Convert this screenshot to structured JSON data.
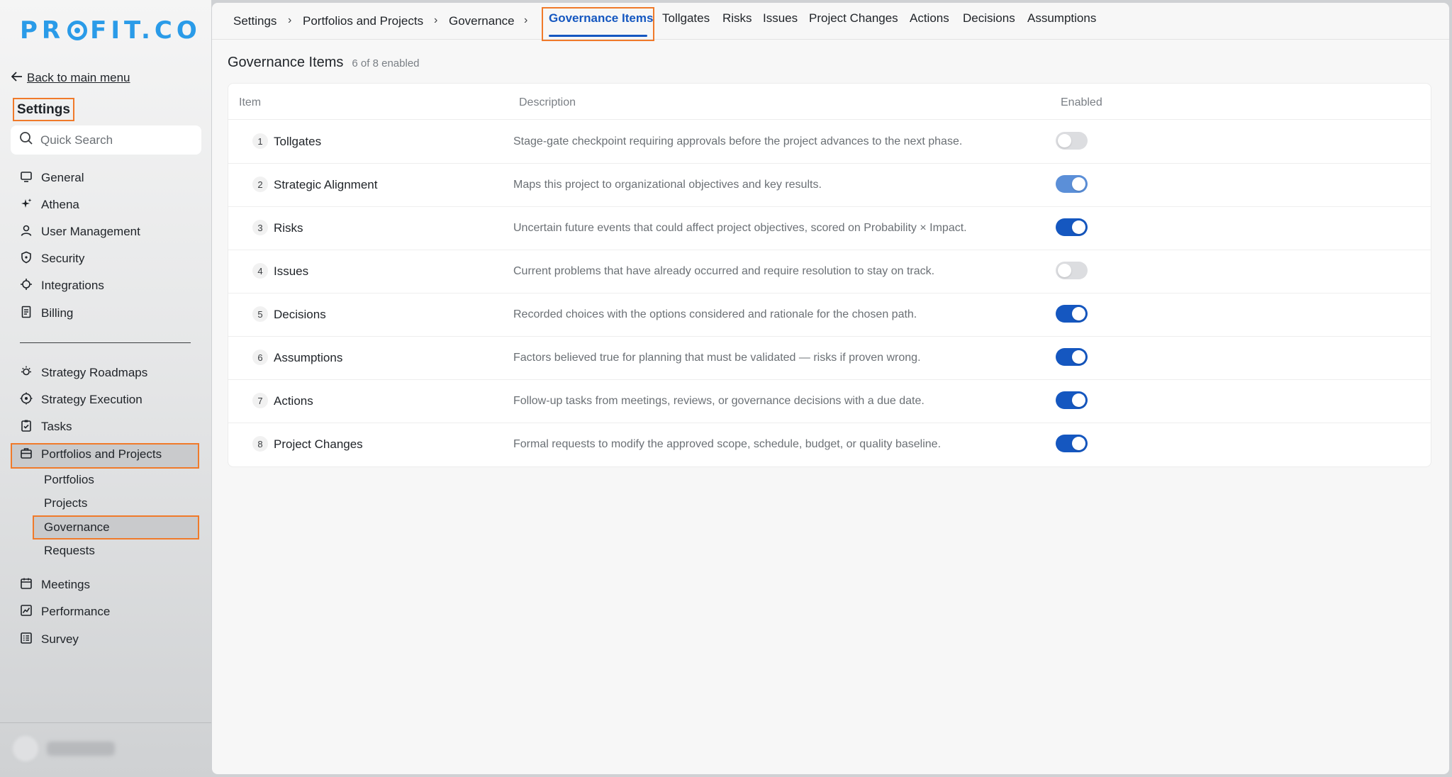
{
  "brand": {
    "logo_left": "PR",
    "logo_right": "FIT.CO"
  },
  "sidebar": {
    "back_label": "Back to main menu",
    "title": "Settings",
    "search_placeholder": "Quick Search",
    "primary_items": [
      {
        "label": "General",
        "icon": "monitor-icon"
      },
      {
        "label": "Athena",
        "icon": "sparkle-icon"
      },
      {
        "label": "User Management",
        "icon": "user-icon"
      },
      {
        "label": "Security",
        "icon": "shield-icon"
      },
      {
        "label": "Integrations",
        "icon": "gear-icon"
      },
      {
        "label": "Billing",
        "icon": "receipt-icon"
      }
    ],
    "secondary_items": [
      {
        "label": "Strategy Roadmaps",
        "icon": "sun-icon"
      },
      {
        "label": "Strategy Execution",
        "icon": "crosshair-icon"
      },
      {
        "label": "Tasks",
        "icon": "clipboard-icon"
      },
      {
        "label": "Portfolios and Projects",
        "icon": "briefcase-icon"
      }
    ],
    "sub_items": [
      "Portfolios",
      "Projects",
      "Governance",
      "Requests"
    ],
    "tertiary_items": [
      {
        "label": "Meetings",
        "icon": "calendar-icon"
      },
      {
        "label": "Performance",
        "icon": "chart-icon"
      },
      {
        "label": "Survey",
        "icon": "list-icon"
      }
    ]
  },
  "breadcrumb": [
    "Settings",
    "Portfolios and Projects",
    "Governance"
  ],
  "tabs": [
    "Governance Items",
    "Tollgates",
    "Risks",
    "Issues",
    "Project Changes",
    "Actions",
    "Decisions",
    "Assumptions"
  ],
  "active_tab": "Governance Items",
  "page": {
    "title": "Governance Items",
    "count": "6 of 8 enabled"
  },
  "table": {
    "headers": {
      "item": "Item",
      "description": "Description",
      "enabled": "Enabled"
    },
    "rows": [
      {
        "num": "1",
        "name": "Tollgates",
        "description": "Stage-gate checkpoint requiring approvals before the project advances to the next phase.",
        "enabled": false
      },
      {
        "num": "2",
        "name": "Strategic Alignment",
        "description": "Maps this project to organizational objectives and key results.",
        "enabled": true
      },
      {
        "num": "3",
        "name": "Risks",
        "description": "Uncertain future events that could affect project objectives, scored on Probability × Impact.",
        "enabled": true
      },
      {
        "num": "4",
        "name": "Issues",
        "description": "Current problems that have already occurred and require resolution to stay on track.",
        "enabled": false
      },
      {
        "num": "5",
        "name": "Decisions",
        "description": "Recorded choices with the options considered and rationale for the chosen path.",
        "enabled": true
      },
      {
        "num": "6",
        "name": "Assumptions",
        "description": "Factors believed true for planning that must be validated — risks if proven wrong.",
        "enabled": true
      },
      {
        "num": "7",
        "name": "Actions",
        "description": "Follow-up tasks from meetings, reviews, or governance decisions with a due date.",
        "enabled": true
      },
      {
        "num": "8",
        "name": "Project Changes",
        "description": "Formal requests to modify the approved scope, schedule, budget, or quality baseline.",
        "enabled": true
      }
    ]
  },
  "colors": {
    "accent": "#1557c0",
    "highlight": "#f07a2a",
    "logo": "#2a9be8"
  }
}
